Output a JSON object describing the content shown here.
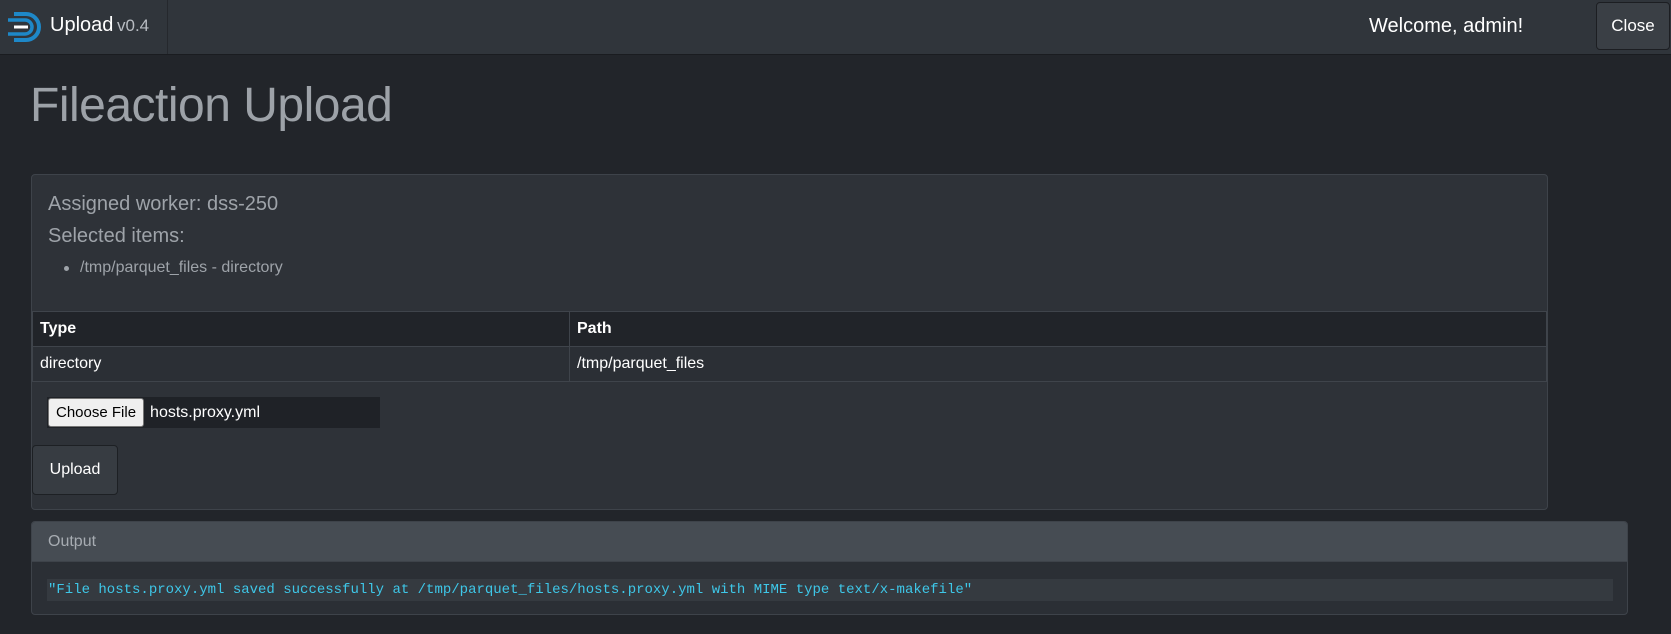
{
  "navbar": {
    "app_name": "Upload",
    "version": "v0.4",
    "welcome": "Welcome, admin!",
    "close_label": "Close",
    "logo_icon": "logo-icon"
  },
  "page": {
    "title": "Fileaction Upload"
  },
  "details": {
    "assigned_worker": "Assigned worker: dss-250",
    "selected_items_title": "Selected items:",
    "selected_items": [
      "/tmp/parquet_files - directory"
    ]
  },
  "table": {
    "headers": [
      "Type",
      "Path"
    ],
    "rows": [
      [
        "directory",
        "/tmp/parquet_files"
      ]
    ]
  },
  "file_input": {
    "button_label": "Choose File",
    "file_name": "hosts.proxy.yml"
  },
  "upload_label": "Upload",
  "output": {
    "title": "Output",
    "message": "\"File hosts.proxy.yml saved successfully at /tmp/parquet_files/hosts.proxy.yml with MIME type text/x-makefile\""
  },
  "colors": {
    "background": "#22252a",
    "navbar": "#30353b",
    "card": "#2e3238",
    "output_text": "#3ec7e8",
    "logo_accent": "#1e88c8"
  }
}
